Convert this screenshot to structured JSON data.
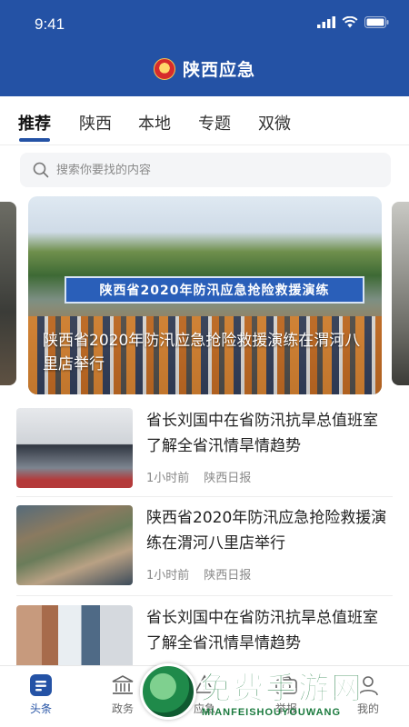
{
  "status_bar": {
    "time": "9:41"
  },
  "header": {
    "title": "陕西应急"
  },
  "tabs": [
    {
      "label": "推荐",
      "active": true
    },
    {
      "label": "陕西",
      "active": false
    },
    {
      "label": "本地",
      "active": false
    },
    {
      "label": "专题",
      "active": false
    },
    {
      "label": "双微",
      "active": false
    }
  ],
  "search": {
    "placeholder": "搜索你要找的内容"
  },
  "banner": {
    "stage_text": "陕西省2020年防汛应急抢险救援演练",
    "caption": "陕西省2020年防汛应急抢险救援演练在渭河八里店举行"
  },
  "news": [
    {
      "headline": "省长刘国中在省防汛抗旱总值班室了解全省汛情旱情趋势",
      "time": "1小时前",
      "source": "陕西日报"
    },
    {
      "headline": "陕西省2020年防汛应急抢险救援演练在渭河八里店举行",
      "time": "1小时前",
      "source": "陕西日报"
    },
    {
      "headline": "省长刘国中在省防汛抗旱总值班室了解全省汛情旱情趋势",
      "time": "",
      "source": ""
    }
  ],
  "bottom_nav": [
    {
      "label": "头条",
      "icon": "headline-icon",
      "active": true
    },
    {
      "label": "政务",
      "icon": "government-icon",
      "active": false
    },
    {
      "label": "应急",
      "icon": "emergency-icon",
      "active": false
    },
    {
      "label": "举报",
      "icon": "camera-icon",
      "active": false
    },
    {
      "label": "我的",
      "icon": "profile-icon",
      "active": false
    }
  ],
  "watermark": {
    "text": "免费手游网",
    "subtext": "MIANFEISHOUYOUWANG"
  },
  "colors": {
    "brand": "#2452a5",
    "background": "#ffffff",
    "muted": "#888888"
  }
}
